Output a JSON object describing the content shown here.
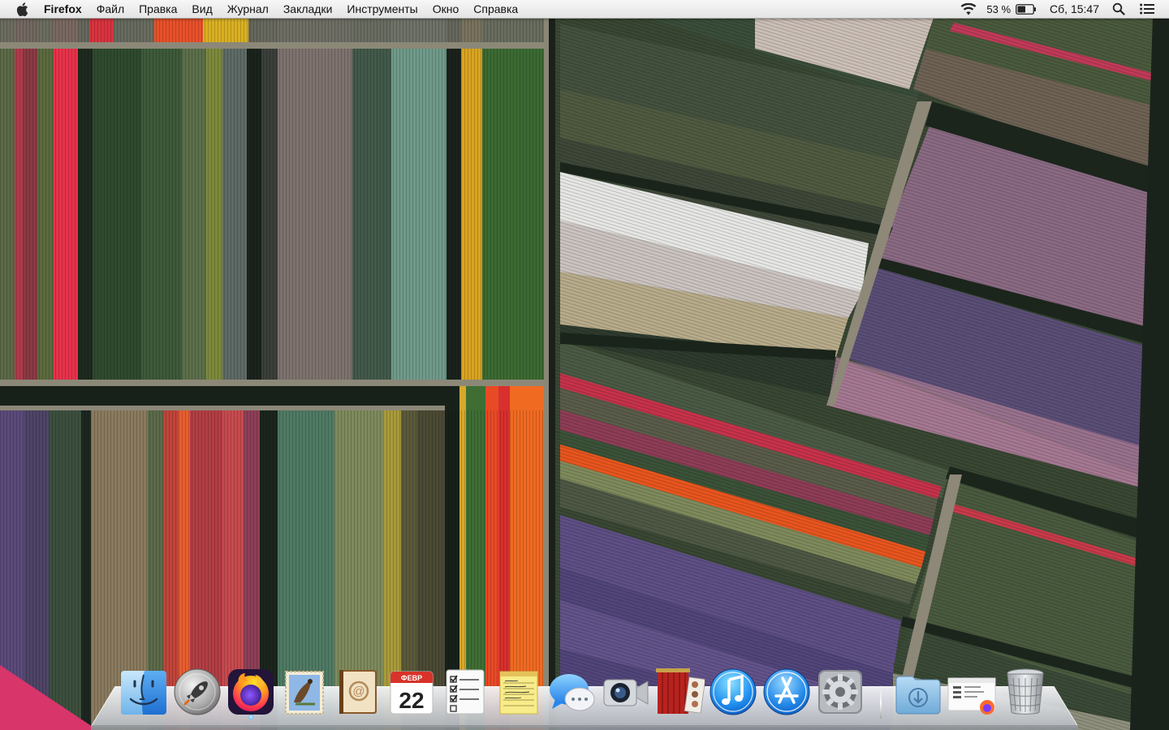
{
  "menubar": {
    "app_name": "Firefox",
    "menus": [
      {
        "label": "Файл"
      },
      {
        "label": "Правка"
      },
      {
        "label": "Вид"
      },
      {
        "label": "Журнал"
      },
      {
        "label": "Закладки"
      },
      {
        "label": "Инструменты"
      },
      {
        "label": "Окно"
      },
      {
        "label": "Справка"
      }
    ],
    "status": {
      "battery_percent": "53 %",
      "battery_level": 0.53,
      "clock": "Сб, 15:47",
      "wifi_icon": "wifi-icon",
      "search_icon": "spotlight-icon",
      "notifications_icon": "notification-center-icon"
    }
  },
  "dock": {
    "apps": [
      {
        "name": "finder",
        "running": false
      },
      {
        "name": "launchpad",
        "running": false
      },
      {
        "name": "firefox",
        "running": true
      },
      {
        "name": "mail",
        "running": false
      },
      {
        "name": "contacts",
        "running": false
      },
      {
        "name": "calendar",
        "running": false,
        "month": "ФЕВР",
        "day": "22"
      },
      {
        "name": "reminders",
        "running": false
      },
      {
        "name": "notes",
        "running": false
      },
      {
        "name": "messages",
        "running": false
      },
      {
        "name": "facetime",
        "running": false
      },
      {
        "name": "photo-booth",
        "running": false
      },
      {
        "name": "itunes",
        "running": false
      },
      {
        "name": "app-store",
        "running": false
      },
      {
        "name": "system-preferences",
        "running": false
      }
    ],
    "stacks": [
      {
        "name": "downloads-folder"
      },
      {
        "name": "minimized-firefox-window"
      },
      {
        "name": "trash"
      }
    ]
  },
  "colors": {
    "menubar_bg": "#ececec",
    "wallpaper_base": "#3d4a3a"
  }
}
